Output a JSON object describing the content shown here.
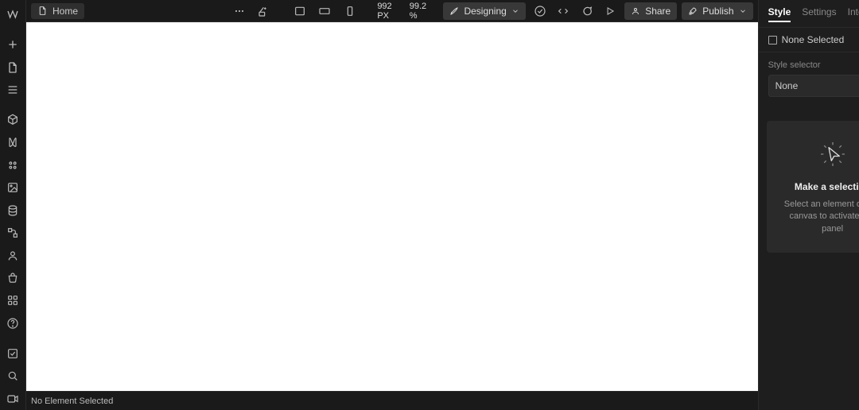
{
  "page": {
    "name": "Home"
  },
  "viewport": {
    "width_px": "992",
    "unit": "PX",
    "zoom": "99.2",
    "zoom_unit": "%"
  },
  "mode": {
    "label": "Designing"
  },
  "actions": {
    "share": "Share",
    "publish": "Publish"
  },
  "status": {
    "selection": "No Element Selected"
  },
  "right_panel": {
    "tabs": {
      "style": "Style",
      "settings": "Settings",
      "interactions": "Interactions"
    },
    "selected_label": "None Selected",
    "selector_label": "Style selector",
    "selector_value": "None",
    "placeholder": {
      "title": "Make a selection",
      "body": "Select an element on the canvas to activate this panel"
    }
  }
}
